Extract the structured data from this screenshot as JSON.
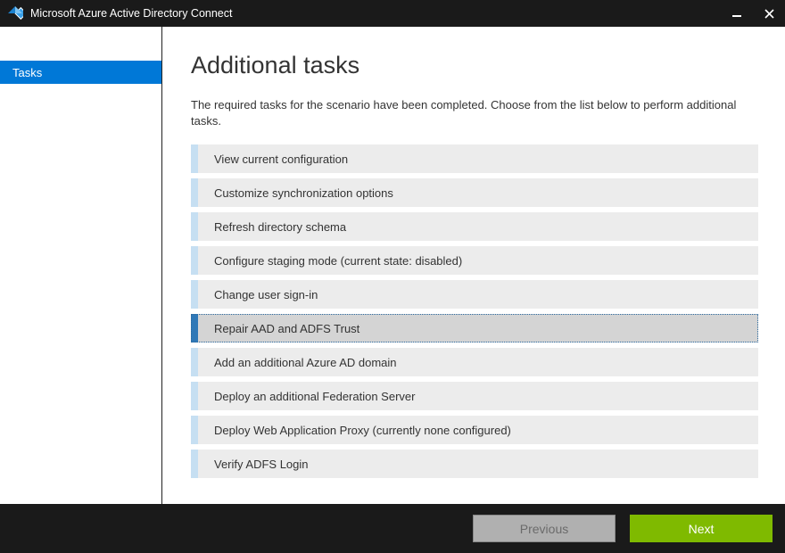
{
  "titlebar": {
    "title": "Microsoft Azure Active Directory Connect"
  },
  "sidebar": {
    "items": [
      {
        "label": "Tasks"
      }
    ]
  },
  "main": {
    "page_title": "Additional tasks",
    "intro": "The required tasks for the scenario have been completed. Choose from the list below to perform additional tasks.",
    "tasks": [
      {
        "label": "View current configuration",
        "selected": false
      },
      {
        "label": "Customize synchronization options",
        "selected": false
      },
      {
        "label": "Refresh directory schema",
        "selected": false
      },
      {
        "label": "Configure staging mode (current state: disabled)",
        "selected": false
      },
      {
        "label": "Change user sign-in",
        "selected": false
      },
      {
        "label": "Repair AAD and ADFS Trust",
        "selected": true
      },
      {
        "label": "Add an additional Azure AD domain",
        "selected": false
      },
      {
        "label": "Deploy an additional Federation Server",
        "selected": false
      },
      {
        "label": "Deploy Web Application Proxy (currently none configured)",
        "selected": false
      },
      {
        "label": "Verify ADFS Login",
        "selected": false
      }
    ]
  },
  "footer": {
    "previous_label": "Previous",
    "next_label": "Next"
  },
  "colors": {
    "accent": "#0078d7",
    "dark": "#1a1a1a",
    "green": "#7fba00"
  }
}
